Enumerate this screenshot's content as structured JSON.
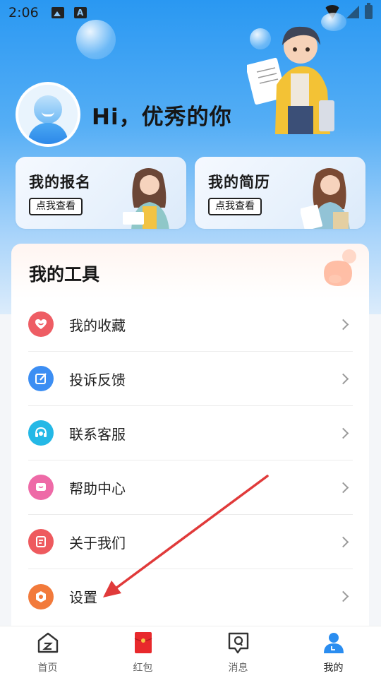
{
  "status_bar": {
    "time": "2:06"
  },
  "profile": {
    "greeting": "Hi，优秀的你"
  },
  "cards": [
    {
      "title": "我的报名",
      "button": "点我查看"
    },
    {
      "title": "我的简历",
      "button": "点我查看"
    }
  ],
  "tools": {
    "title": "我的工具",
    "items": [
      {
        "label": "我的收藏",
        "icon": "heart-icon",
        "color": "#ee5d64"
      },
      {
        "label": "投诉反馈",
        "icon": "edit-icon",
        "color": "#3c8ef3"
      },
      {
        "label": "联系客服",
        "icon": "headset-icon",
        "color": "#24b8e6"
      },
      {
        "label": "帮助中心",
        "icon": "message-icon",
        "color": "#ee6aa7"
      },
      {
        "label": "关于我们",
        "icon": "document-icon",
        "color": "#ee5a5e"
      },
      {
        "label": "设置",
        "icon": "settings-icon",
        "color": "#f27a3b"
      }
    ]
  },
  "tabbar": {
    "tabs": [
      {
        "label": "首页",
        "icon": "home-icon"
      },
      {
        "label": "红包",
        "icon": "red-packet-icon"
      },
      {
        "label": "消息",
        "icon": "message-icon"
      },
      {
        "label": "我的",
        "icon": "profile-icon",
        "active": true
      }
    ]
  },
  "colors": {
    "primary": "#2a98f2",
    "arrow": "#e03a3a"
  }
}
